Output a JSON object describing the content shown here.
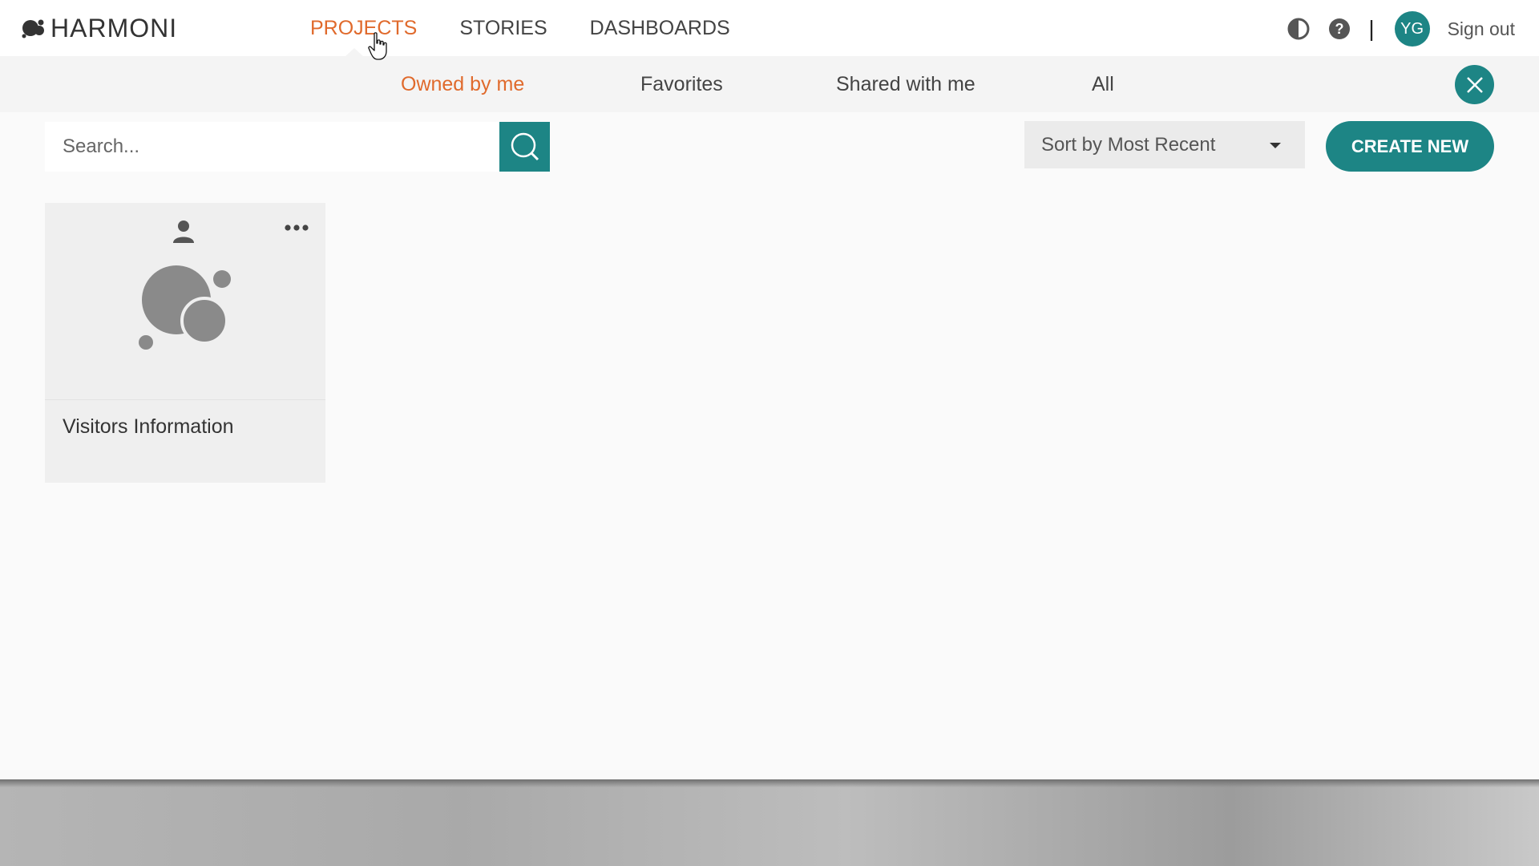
{
  "app": {
    "brand": "HARMONI"
  },
  "main_nav": {
    "items": [
      {
        "label": "PROJECTS",
        "active": true
      },
      {
        "label": "STORIES",
        "active": false
      },
      {
        "label": "DASHBOARDS",
        "active": false
      }
    ]
  },
  "header_tools": {
    "contrast_icon": "contrast-icon",
    "help_icon": "help-icon",
    "separator": "|",
    "avatar_initials": "YG",
    "sign_out": "Sign out"
  },
  "sub_nav": {
    "tabs": [
      {
        "label": "Owned by me",
        "active": true
      },
      {
        "label": "Favorites",
        "active": false
      },
      {
        "label": "Shared with me",
        "active": false
      },
      {
        "label": "All",
        "active": false
      }
    ],
    "close_icon": "close-icon"
  },
  "toolbar": {
    "search_placeholder": "Search...",
    "search_icon": "search-icon",
    "sort_label": "Sort by Most Recent",
    "create_label": "CREATE NEW"
  },
  "projects": [
    {
      "title": "Visitors Information",
      "owner_icon": "person-icon",
      "menu_icon": "more-icon",
      "thumbnail_icon": "bubbles-icon"
    }
  ],
  "colors": {
    "accent_teal": "#1d8585",
    "active_orange": "#e06a2c",
    "text_dark": "#444444"
  }
}
